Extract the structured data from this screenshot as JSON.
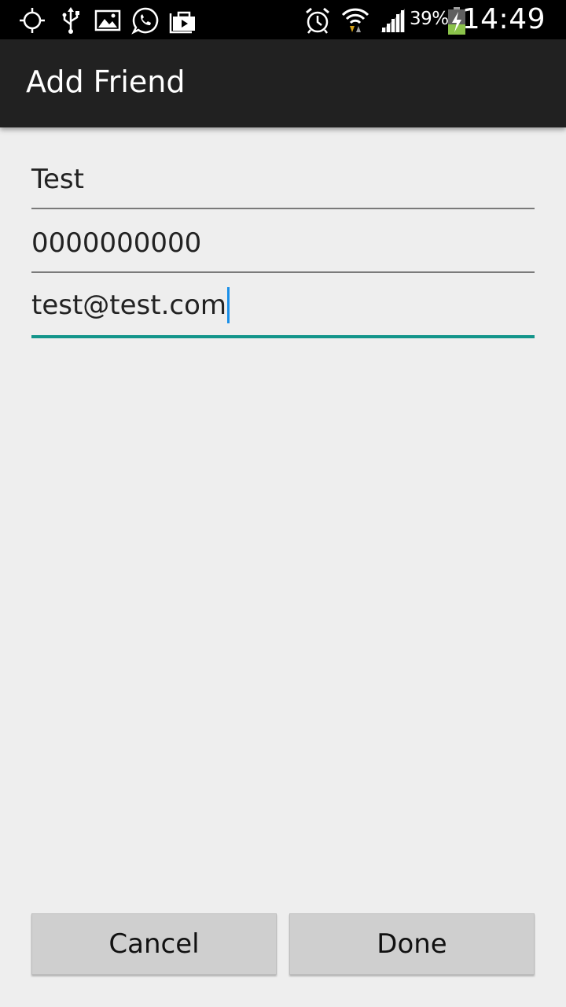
{
  "status_bar": {
    "icons_left": [
      "gps-icon",
      "usb-icon",
      "image-icon",
      "whatsapp-icon",
      "briefcase-play-icon"
    ],
    "icons_right": [
      "alarm-icon",
      "wifi-icon",
      "signal-icon",
      "battery-charging-icon"
    ],
    "battery_percent": "39%",
    "time": "14:49"
  },
  "action_bar": {
    "title": "Add Friend"
  },
  "form": {
    "name_value": "Test",
    "phone_value": "0000000000",
    "email_value": "test@test.com"
  },
  "buttons": {
    "cancel_label": "Cancel",
    "done_label": "Done"
  },
  "colors": {
    "status_bar_bg": "#000000",
    "action_bar_bg": "#212121",
    "page_bg": "#eeeeee",
    "focus_accent": "#13958a",
    "cursor": "#1a8fe8",
    "button_bg": "#cfcfcf",
    "battery_fill": "#8bc34a"
  }
}
